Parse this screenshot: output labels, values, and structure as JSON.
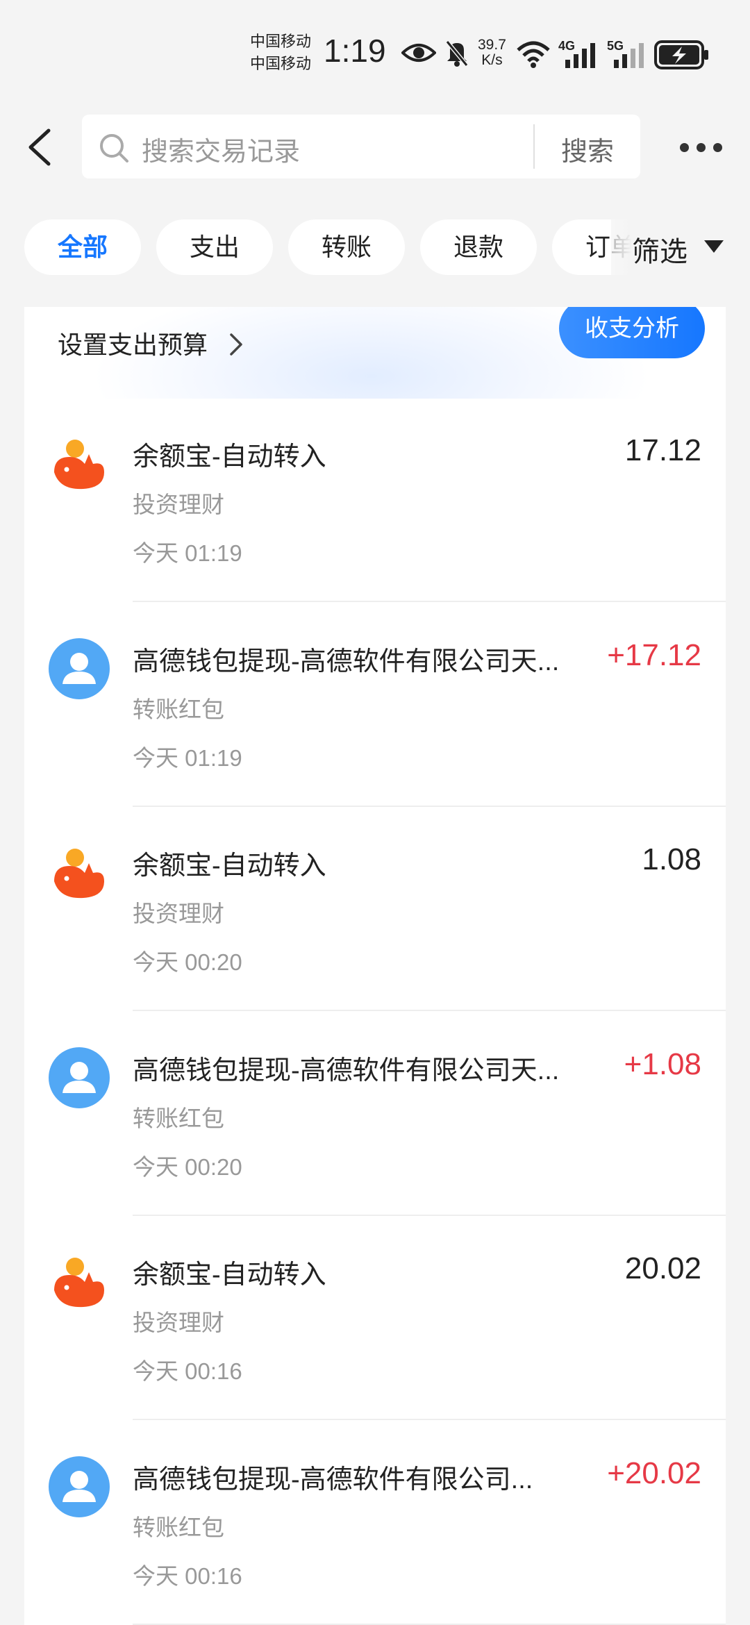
{
  "status_bar": {
    "carrier_1": "中国移动",
    "carrier_2": "中国移动",
    "time": "1:19",
    "net_speed_value": "39.7",
    "net_speed_unit": "K/s",
    "network_1": "4G",
    "network_2": "5G",
    "icons": [
      "eye-icon",
      "bell-off-icon",
      "wifi-icon",
      "signal-4g-icon",
      "signal-5g-icon",
      "battery-charging-icon"
    ]
  },
  "header": {
    "search_placeholder": "搜索交易记录",
    "search_button": "搜索"
  },
  "tabs": [
    {
      "label": "全部",
      "active": true
    },
    {
      "label": "支出",
      "active": false
    },
    {
      "label": "转账",
      "active": false
    },
    {
      "label": "退款",
      "active": false
    },
    {
      "label": "订单",
      "active": false
    }
  ],
  "filter": {
    "label": "筛选"
  },
  "budget": {
    "label": "设置支出预算",
    "analysis_button": "收支分析"
  },
  "transactions": [
    {
      "icon": "yuebao-icon",
      "title": "余额宝-自动转入",
      "category": "投资理财",
      "time": "今天 01:19",
      "amount": "17.12",
      "income": false
    },
    {
      "icon": "user-avatar-icon",
      "title": "高德钱包提现-高德软件有限公司天...",
      "category": "转账红包",
      "time": "今天 01:19",
      "amount": "+17.12",
      "income": true
    },
    {
      "icon": "yuebao-icon",
      "title": "余额宝-自动转入",
      "category": "投资理财",
      "time": "今天 00:20",
      "amount": "1.08",
      "income": false
    },
    {
      "icon": "user-avatar-icon",
      "title": "高德钱包提现-高德软件有限公司天...",
      "category": "转账红包",
      "time": "今天 00:20",
      "amount": "+1.08",
      "income": true
    },
    {
      "icon": "yuebao-icon",
      "title": "余额宝-自动转入",
      "category": "投资理财",
      "time": "今天 00:16",
      "amount": "20.02",
      "income": false
    },
    {
      "icon": "user-avatar-icon",
      "title": "高德钱包提现-高德软件有限公司...",
      "category": "转账红包",
      "time": "今天 00:16",
      "amount": "+20.02",
      "income": true
    }
  ],
  "colors": {
    "accent": "#1677ff",
    "income": "#e63946",
    "yuebao_orange": "#f4511e",
    "avatar_blue": "#52a8f5"
  }
}
